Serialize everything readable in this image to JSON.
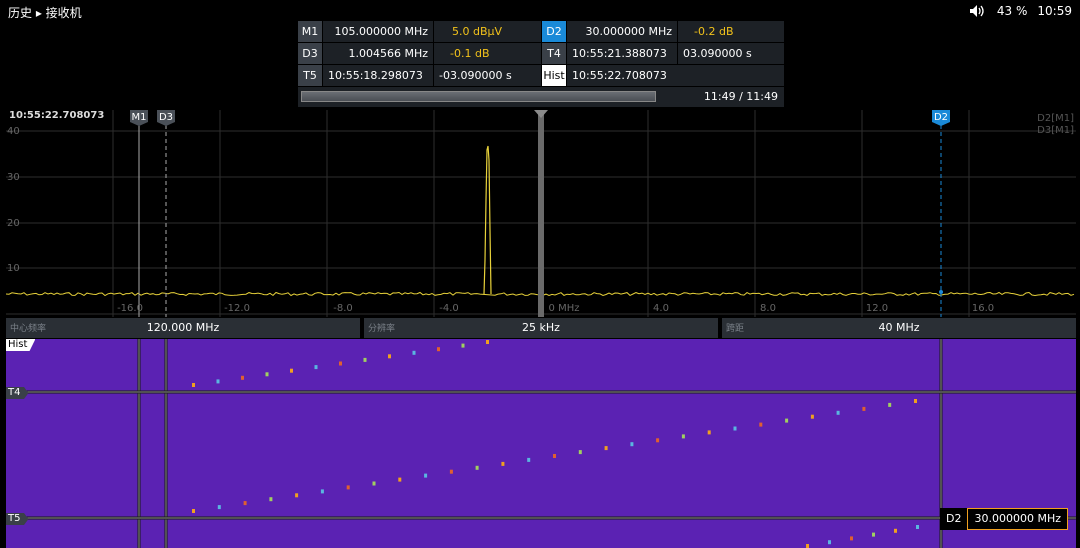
{
  "header": {
    "breadcrumb": "历史 ▸ 接收机",
    "volume_icon": "speaker-icon",
    "battery": "43 %",
    "clock": "10:59"
  },
  "markers": {
    "row1": {
      "tag1": "M1",
      "val1": "105.000000 MHz",
      "lvl1": "5.0 dBµV",
      "tag2": "D2",
      "val2": "30.000000 MHz",
      "lvl2": "-0.2 dB"
    },
    "row2": {
      "tag1": "D3",
      "val1": "1.004566 MHz",
      "lvl1": "-0.1 dB",
      "tag2": "T4",
      "val2": "10:55:21.388073",
      "lvl2": "03.090000 s"
    },
    "row3": {
      "tag1": "T5",
      "val1": "10:55:18.298073",
      "lvl1": "-03.090000 s",
      "tag2": "Hist",
      "val2": "10:55:22.708073"
    },
    "progress_text": "11:49 / 11:49",
    "progress_fraction": 1.0
  },
  "spectrum": {
    "timestamp": "10:55:22.708073",
    "legend1": "D2[M1]",
    "legend2": "D3[M1]",
    "y_ticks": [
      "40",
      "30",
      "20",
      "10"
    ],
    "x_ticks": [
      "-16.0",
      "-12.0",
      "-8.0",
      "-4.0",
      "0 MHz",
      "4.0",
      "8.0",
      "12.0",
      "16.0"
    ],
    "marker_m1": "M1",
    "marker_d3": "D3",
    "marker_d2": "D2"
  },
  "params": {
    "center_label": "中心频率",
    "center_value": "120.000 MHz",
    "rbw_label": "分辨率",
    "rbw_value": "25 kHz",
    "span_label": "跨距",
    "span_value": "40 MHz"
  },
  "waterfall": {
    "hist_tag": "Hist",
    "t4_tag": "T4",
    "t5_tag": "T5",
    "d2_label": "D2",
    "d2_value": "30.000000 MHz"
  },
  "colors": {
    "trace": "#e8d23a",
    "waterfall_bg": "#5b22b3",
    "marker_blue": "#1a8ad8",
    "accent_orange": "#f0a020"
  }
}
